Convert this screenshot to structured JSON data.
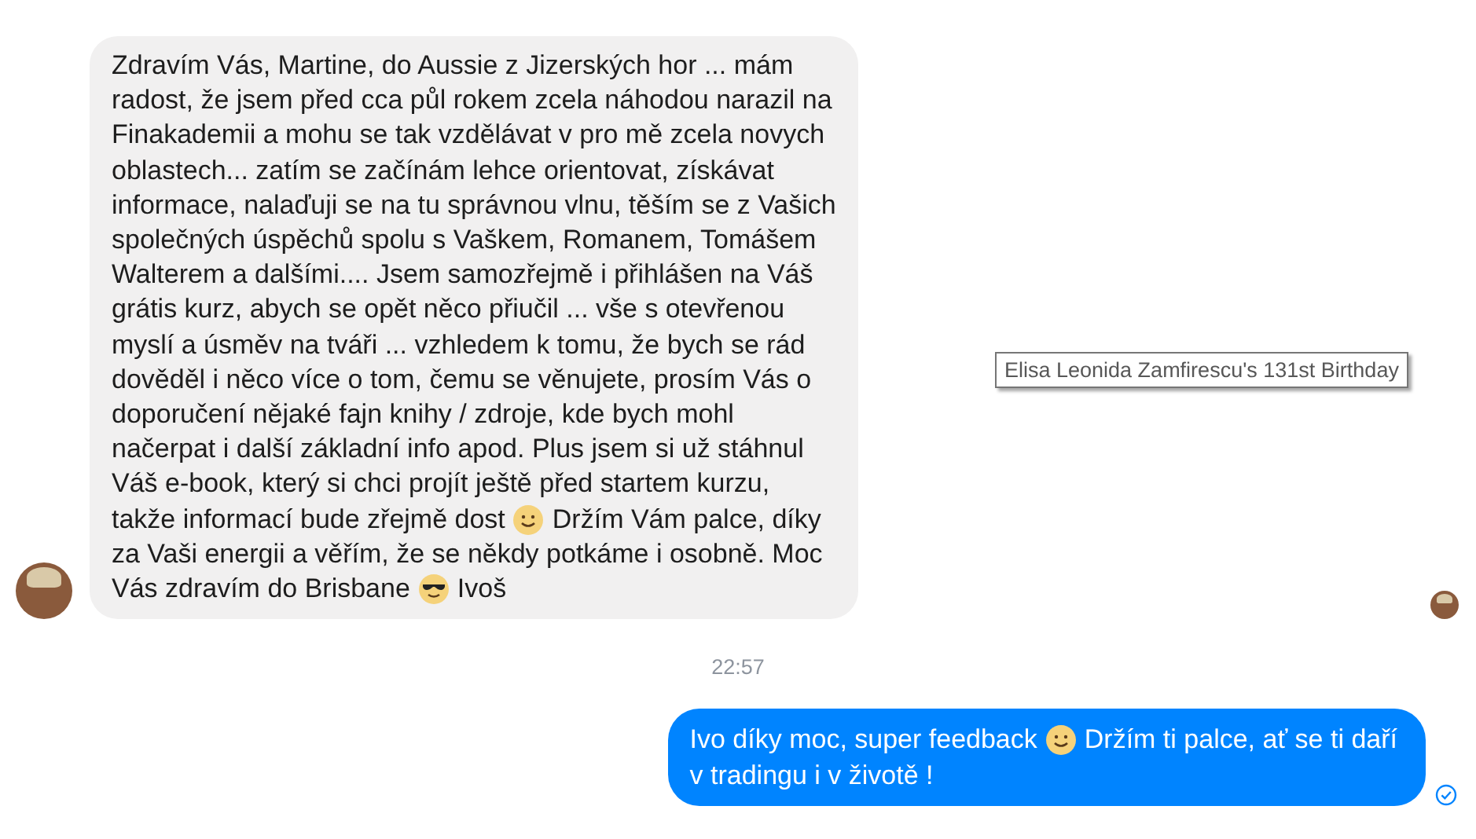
{
  "incoming": {
    "lines": [
      [
        {
          "kind": "text",
          "text": "Zdravím Vás, Martine, do Aussie z Jizerských hor ... mám"
        }
      ],
      [
        {
          "kind": "text",
          "text": "radost, že jsem před cca půl rokem zcela náhodou narazil na"
        }
      ],
      [
        {
          "kind": "text",
          "text": "Finakademii a mohu se tak vzdělávat v pro mě zcela novych"
        }
      ],
      [
        {
          "kind": "text",
          "text": "oblastech... zatím se začínám lehce orientovat, získávat"
        }
      ],
      [
        {
          "kind": "text",
          "text": "informace, nalaďuji se na tu správnou vlnu, těším se z Vašich"
        }
      ],
      [
        {
          "kind": "text",
          "text": "společných úspěchů spolu s Vaškem, Romanem, Tomášem"
        }
      ],
      [
        {
          "kind": "text",
          "text": "Walterem a dalšími.... Jsem samozřejmě i přihlášen na Váš"
        }
      ],
      [
        {
          "kind": "text",
          "text": "grátis kurz, abych se opět něco přiučil ... vše s otevřenou"
        }
      ],
      [
        {
          "kind": "text",
          "text": "myslí a úsměv na tváři ... vzhledem k tomu, že bych se rád"
        }
      ],
      [
        {
          "kind": "text",
          "text": "dověděl i něco více o tom, čemu se věnujete, prosím Vás o"
        }
      ],
      [
        {
          "kind": "text",
          "text": "doporučení nějaké fajn knihy / zdroje, kde bych mohl"
        }
      ],
      [
        {
          "kind": "text",
          "text": "načerpat i další základní info apod. Plus jsem si už stáhnul"
        }
      ],
      [
        {
          "kind": "text",
          "text": "Váš e-book, který si chci projít ještě před startem kurzu,"
        }
      ],
      [
        {
          "kind": "text",
          "text": "takže informací bude zřejmě dost"
        },
        {
          "kind": "smile"
        },
        {
          "kind": "text",
          "text": "Držím Vám palce, díky"
        }
      ],
      [
        {
          "kind": "text",
          "text": "za Vaši energii a věřím, že se někdy potkáme i osobně. Moc"
        }
      ],
      [
        {
          "kind": "text",
          "text": "Vás zdravím do Brisbane"
        },
        {
          "kind": "sunglasses"
        },
        {
          "kind": "text",
          "text": "Ivoš"
        }
      ]
    ]
  },
  "tooltip": {
    "text": "Elisa Leonida Zamfirescu's 131st Birthday"
  },
  "timestamp": "22:57",
  "outgoing": {
    "lines": [
      [
        {
          "kind": "text",
          "text": "Ivo díky moc, super feedback"
        },
        {
          "kind": "smile"
        },
        {
          "kind": "text",
          "text": "Držím ti palce, ať se ti daří"
        }
      ],
      [
        {
          "kind": "text",
          "text": "v tradingu i v životě !"
        }
      ]
    ]
  }
}
